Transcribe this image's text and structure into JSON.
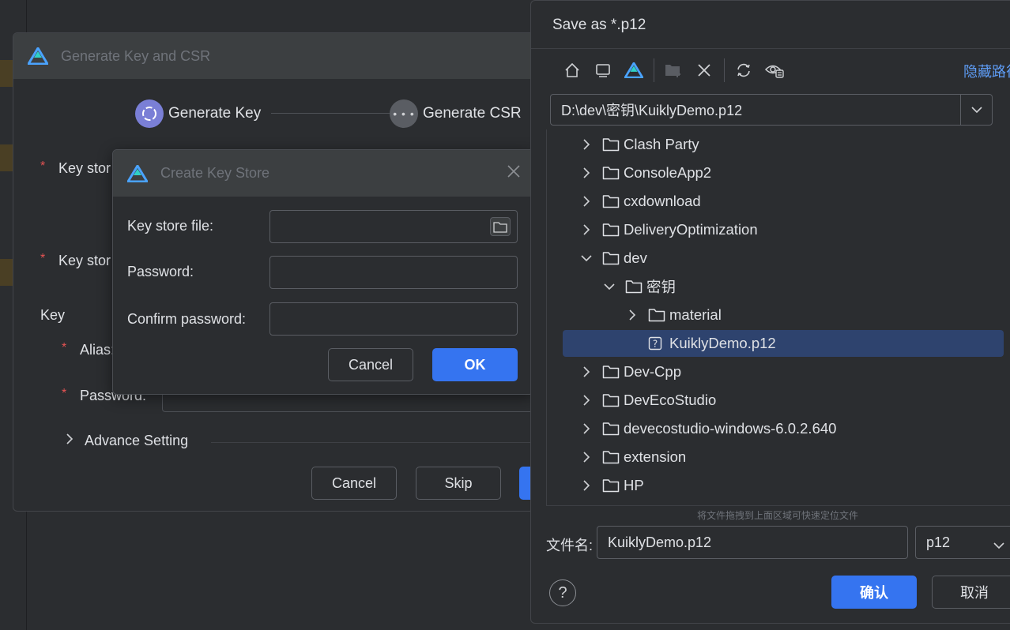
{
  "generate_dialog": {
    "title": "Generate Key and CSR",
    "steps": [
      {
        "label": "Generate Key",
        "state": "active"
      },
      {
        "label": "Generate CSR",
        "state": "pending"
      }
    ],
    "required_mark": "*",
    "key_store_label_1": "Key stor",
    "key_store_label_2": "Key stor",
    "key_section": "Key",
    "alias_label": "Alias:",
    "password_label": "Password:",
    "advance_setting": "Advance Setting",
    "buttons": {
      "cancel": "Cancel",
      "skip": "Skip"
    }
  },
  "create_key_store": {
    "title": "Create Key Store",
    "fields": {
      "key_store_file": {
        "label": "Key store file:",
        "value": ""
      },
      "password": {
        "label": "Password:",
        "value": ""
      },
      "confirm_password": {
        "label": "Confirm password:",
        "value": ""
      }
    },
    "buttons": {
      "cancel": "Cancel",
      "ok": "OK"
    }
  },
  "save_dialog": {
    "title": "Save as *.p12",
    "toolbar_icons": [
      "home-icon",
      "desktop-icon",
      "deveco-logo-icon",
      "new-folder-icon",
      "delete-icon",
      "refresh-icon",
      "toggle-hidden-icon"
    ],
    "hide_path_link": "隐藏路径",
    "path": "D:\\dev\\密钥\\KuiklyDemo.p12",
    "tree": [
      {
        "label": "Clash Party",
        "depth": 0,
        "expanded": false,
        "type": "folder"
      },
      {
        "label": "ConsoleApp2",
        "depth": 0,
        "expanded": false,
        "type": "folder"
      },
      {
        "label": "cxdownload",
        "depth": 0,
        "expanded": false,
        "type": "folder"
      },
      {
        "label": "DeliveryOptimization",
        "depth": 0,
        "expanded": false,
        "type": "folder"
      },
      {
        "label": "dev",
        "depth": 0,
        "expanded": true,
        "type": "folder"
      },
      {
        "label": "密钥",
        "depth": 1,
        "expanded": true,
        "type": "folder"
      },
      {
        "label": "material",
        "depth": 2,
        "expanded": false,
        "type": "folder"
      },
      {
        "label": "KuiklyDemo.p12",
        "depth": 2,
        "expanded": false,
        "type": "file",
        "selected": true
      },
      {
        "label": "Dev-Cpp",
        "depth": 0,
        "expanded": false,
        "type": "folder"
      },
      {
        "label": "DevEcoStudio",
        "depth": 0,
        "expanded": false,
        "type": "folder"
      },
      {
        "label": "devecostudio-windows-6.0.2.640",
        "depth": 0,
        "expanded": false,
        "type": "folder"
      },
      {
        "label": "extension",
        "depth": 0,
        "expanded": false,
        "type": "folder"
      },
      {
        "label": "HP",
        "depth": 0,
        "expanded": false,
        "type": "folder"
      }
    ],
    "drag_hint": "将文件拖拽到上面区域可快速定位文件",
    "file_name_label": "文件名:",
    "file_name_value": "KuiklyDemo.p12",
    "file_type": "p12",
    "help": "?",
    "buttons": {
      "confirm": "确认",
      "cancel": "取消"
    }
  },
  "colors": {
    "accent": "#3574f0",
    "background": "#2b2d30",
    "title_bar": "#3c3f41",
    "selection": "#2e436e",
    "link": "#5e9cf5",
    "required": "#e55353"
  }
}
